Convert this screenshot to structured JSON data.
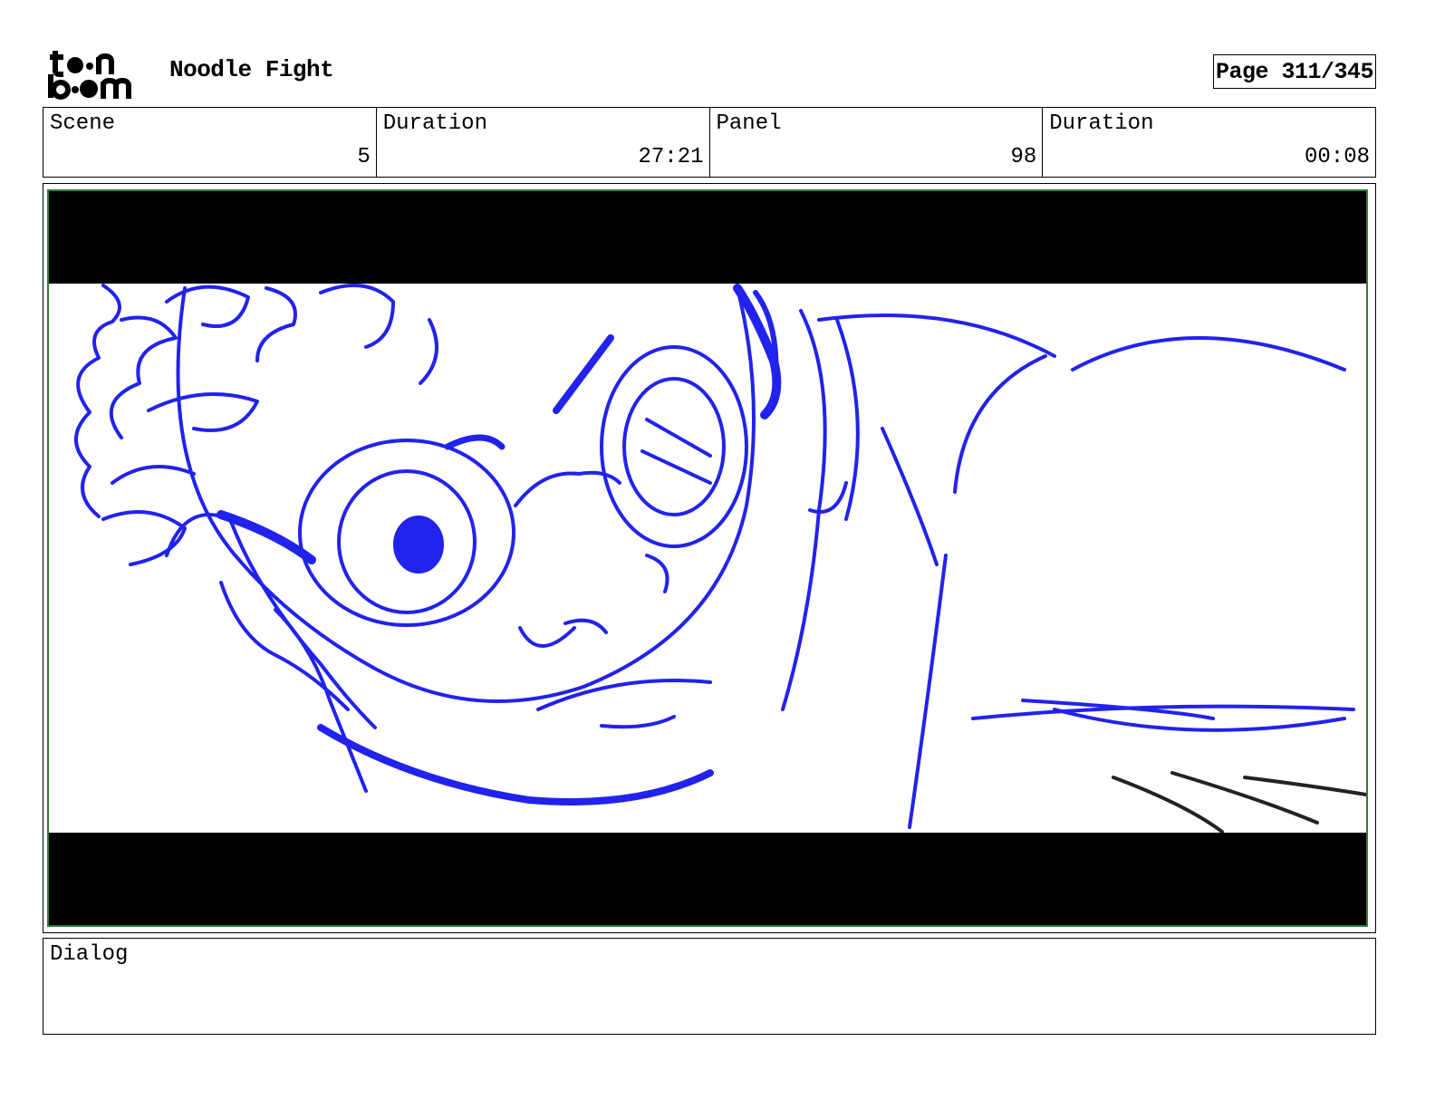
{
  "header": {
    "logo_text": "toonboom",
    "project_title": "Noodle Fight",
    "page_label": "Page 311/345"
  },
  "info": {
    "scene_label": "Scene",
    "scene_value": "5",
    "scene_duration_label": "Duration",
    "scene_duration_value": "27:21",
    "panel_label": "Panel",
    "panel_value": "98",
    "panel_duration_label": "Duration",
    "panel_duration_value": "00:08"
  },
  "panel": {
    "sketch_color": "#2222ee",
    "frame_color": "#2e7d32"
  },
  "dialog": {
    "label": "Dialog",
    "text": ""
  }
}
